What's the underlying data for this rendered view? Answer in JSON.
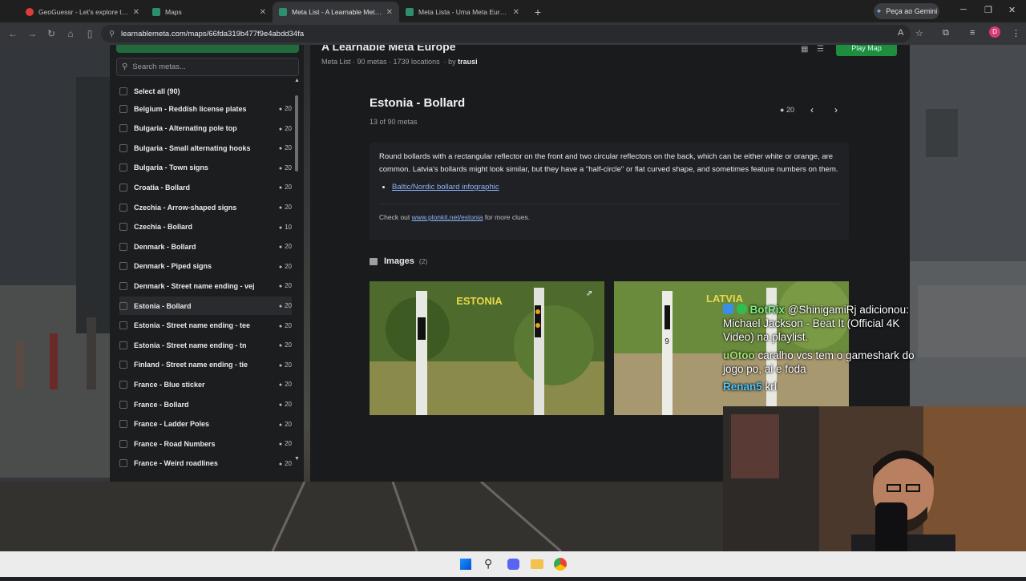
{
  "tabs": [
    {
      "title": "GeoGuessr - Let's explore the w",
      "fav_color": "#e03b3b",
      "active": false
    },
    {
      "title": "Maps",
      "fav_color": "#2d8f6b",
      "active": false
    },
    {
      "title": "Meta List - A Learnable Meta E",
      "fav_color": "#2d8f6b",
      "active": true
    },
    {
      "title": "Meta Lista - Uma Meta Europa",
      "fav_color": "#2d8f6b",
      "active": false
    }
  ],
  "gemini_label": "Peça ao Gemini",
  "url": "learnablemeta.com/maps/66fda319b477f9e4abdd34fa",
  "header": {
    "title": "A Learnable Meta Europe",
    "meta_list": "Meta List · 90 metas · 1739 locations",
    "by": "by",
    "author": "trausi",
    "play_label": "Play Map"
  },
  "sidebar": {
    "search_placeholder": "Search metas...",
    "select_all": "Select all (90)",
    "items": [
      {
        "label": "Belgium - Reddish license plates",
        "count": "20"
      },
      {
        "label": "Bulgaria - Alternating pole top",
        "count": "20"
      },
      {
        "label": "Bulgaria - Small alternating hooks",
        "count": "20"
      },
      {
        "label": "Bulgaria - Town signs",
        "count": "20"
      },
      {
        "label": "Croatia - Bollard",
        "count": "20"
      },
      {
        "label": "Czechia - Arrow-shaped signs",
        "count": "20"
      },
      {
        "label": "Czechia - Bollard",
        "count": "10"
      },
      {
        "label": "Denmark - Bollard",
        "count": "20"
      },
      {
        "label": "Denmark - Piped signs",
        "count": "20"
      },
      {
        "label": "Denmark - Street name ending - vej",
        "count": "20"
      },
      {
        "label": "Estonia - Bollard",
        "count": "20"
      },
      {
        "label": "Estonia - Street name ending - tee",
        "count": "20"
      },
      {
        "label": "Estonia - Street name ending - tn",
        "count": "20"
      },
      {
        "label": "Finland - Street name ending - tie",
        "count": "20"
      },
      {
        "label": "France - Blue sticker",
        "count": "20"
      },
      {
        "label": "France - Bollard",
        "count": "20"
      },
      {
        "label": "France - Ladder Poles",
        "count": "20"
      },
      {
        "label": "France - Road Numbers",
        "count": "20"
      },
      {
        "label": "France - Weird roadlines",
        "count": "20"
      }
    ]
  },
  "meta": {
    "title": "Estonia - Bollard",
    "index": "13 of 90 metas",
    "locations": "20",
    "description": "Round bollards with a rectangular reflector on the front and two circular reflectors on the back, which can be either white or orange, are common. Latvia's bollards might look similar, but they have a \"half-circle\" or flat curved shape, and sometimes feature numbers on them.",
    "link_label": "Baltic/Nordic bollard infographic",
    "footer_pre": "Check out",
    "footer_link": "www.plonkit.net/estonia",
    "footer_post": "for more clues.",
    "images_label": "Images",
    "images_count": "(2)",
    "image1_label": "ESTONIA",
    "image2_label": "LATVIA"
  },
  "chat": [
    {
      "user": "BotRix",
      "text": "@ShinigamiRj adicionou: Michael Jackson - Beat It (Official 4K Video) na playlist."
    },
    {
      "user": "uOtoo",
      "text": "caralho vcs tem o gameshark do jogo po, ai e foda"
    },
    {
      "user": "Renan5",
      "text": "krl"
    }
  ]
}
